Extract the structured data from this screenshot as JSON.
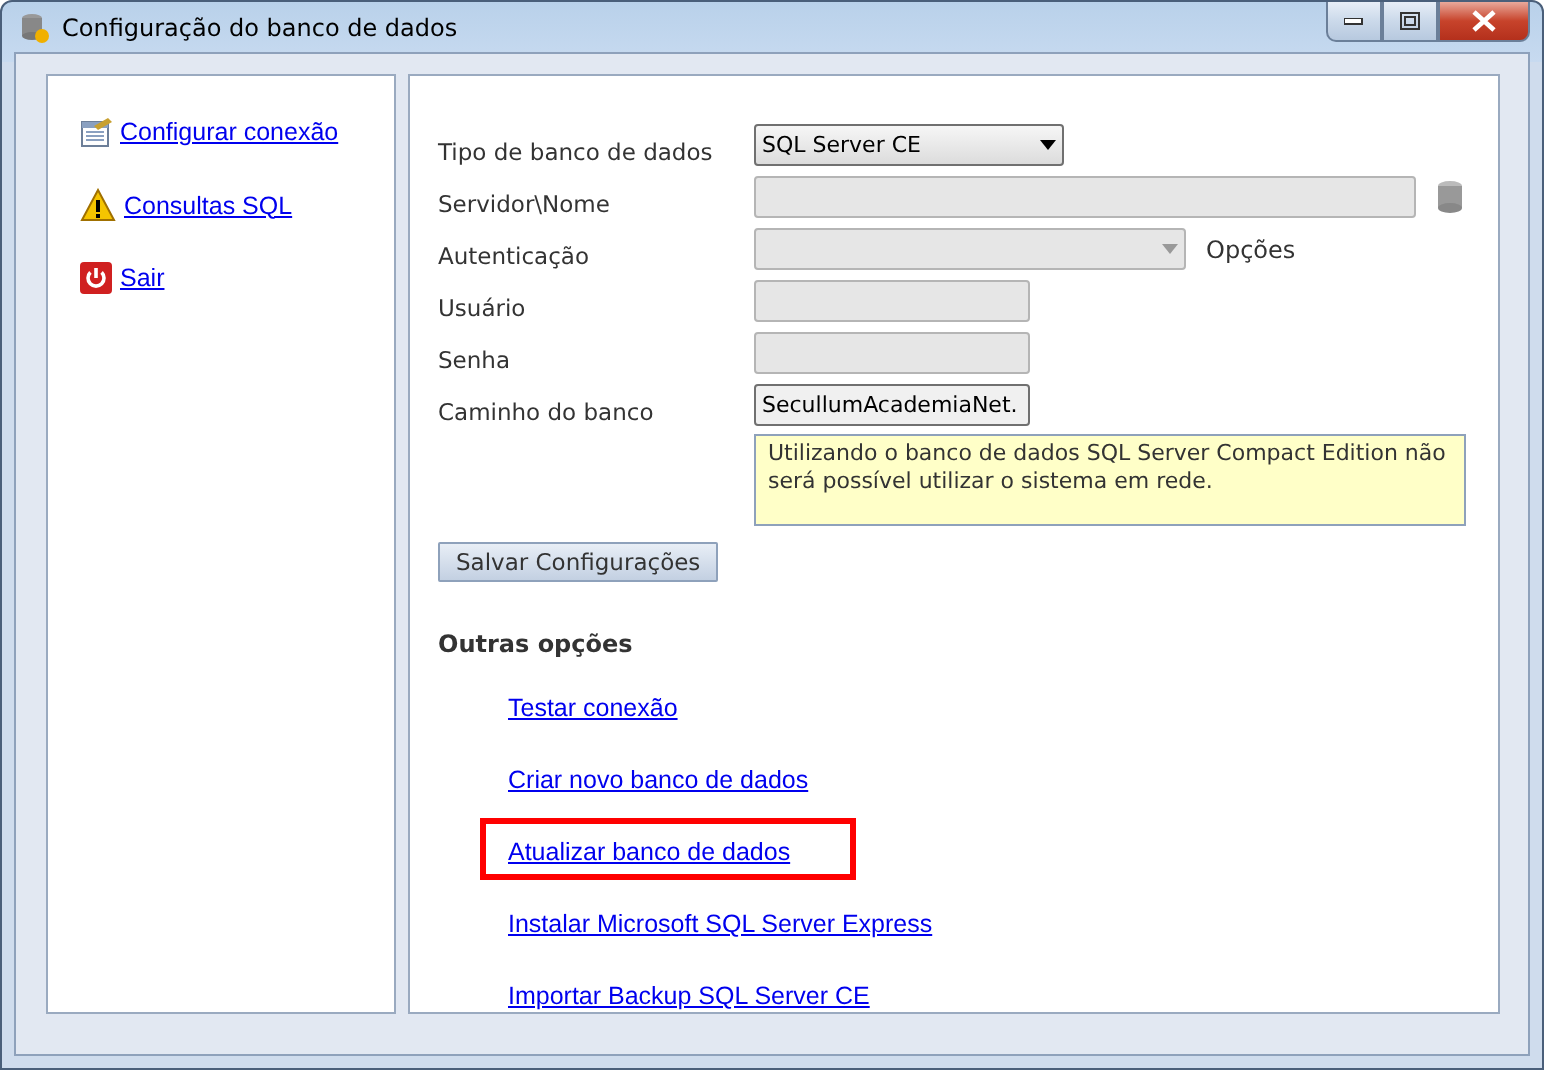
{
  "window": {
    "title": "Configuração do banco de dados"
  },
  "sidebar": {
    "items": [
      {
        "label": "Configurar conexão",
        "kind": "config"
      },
      {
        "label": "Consultas SQL",
        "kind": "warning"
      },
      {
        "label": "Sair",
        "kind": "exit"
      }
    ]
  },
  "form": {
    "fields": [
      {
        "label": "Tipo de banco de dados",
        "kind": "select",
        "value": "SQL Server CE",
        "disabled": false
      },
      {
        "label": "Servidor\\Nome",
        "kind": "text",
        "disabled": true
      },
      {
        "label": "Autenticação",
        "kind": "select",
        "disabled": true,
        "side_label": "Opções"
      },
      {
        "label": "Usuário",
        "kind": "text",
        "disabled": true
      },
      {
        "label": "Senha",
        "kind": "text",
        "disabled": true
      },
      {
        "label": "Caminho do banco",
        "kind": "text",
        "value": "SecullumAcademiaNet.",
        "disabled": false
      }
    ],
    "note": "Utilizando o banco de dados SQL Server Compact Edition não será possível utilizar o sistema em rede.",
    "save_button": "Salvar Configurações"
  },
  "other_options": {
    "title": "Outras opções",
    "links": [
      {
        "label": "Testar conexão",
        "highlighted": false
      },
      {
        "label": "Criar novo banco de dados",
        "highlighted": false
      },
      {
        "label": "Atualizar banco de dados",
        "highlighted": true
      },
      {
        "label": "Instalar Microsoft SQL Server Express",
        "highlighted": false
      },
      {
        "label": "Importar Backup SQL Server CE",
        "highlighted": false
      }
    ]
  }
}
